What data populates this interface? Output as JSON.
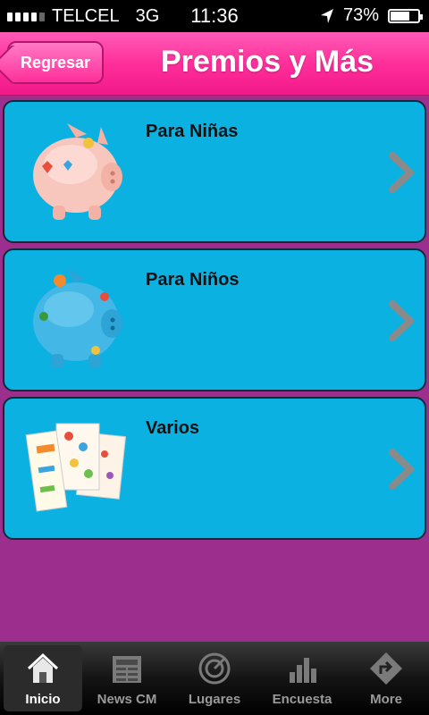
{
  "status": {
    "carrier": "TELCEL",
    "network": "3G",
    "time": "11:36",
    "battery": "73%",
    "battery_level": 0.73
  },
  "nav": {
    "back_label": "Regresar",
    "title": "Premios y Más"
  },
  "items": [
    {
      "label": "Para Niñas"
    },
    {
      "label": "Para Niños"
    },
    {
      "label": "Varios"
    }
  ],
  "tabs": [
    {
      "label": "Inicio",
      "icon": "home-icon",
      "active": true
    },
    {
      "label": "News CM",
      "icon": "newspaper-icon"
    },
    {
      "label": "Lugares",
      "icon": "radar-icon"
    },
    {
      "label": "Encuesta",
      "icon": "bar-chart-icon"
    },
    {
      "label": "More",
      "icon": "more-icon"
    }
  ],
  "colors": {
    "accent": "#ff2f9a",
    "card": "#0bb1e1",
    "background": "#9c2f8e"
  }
}
